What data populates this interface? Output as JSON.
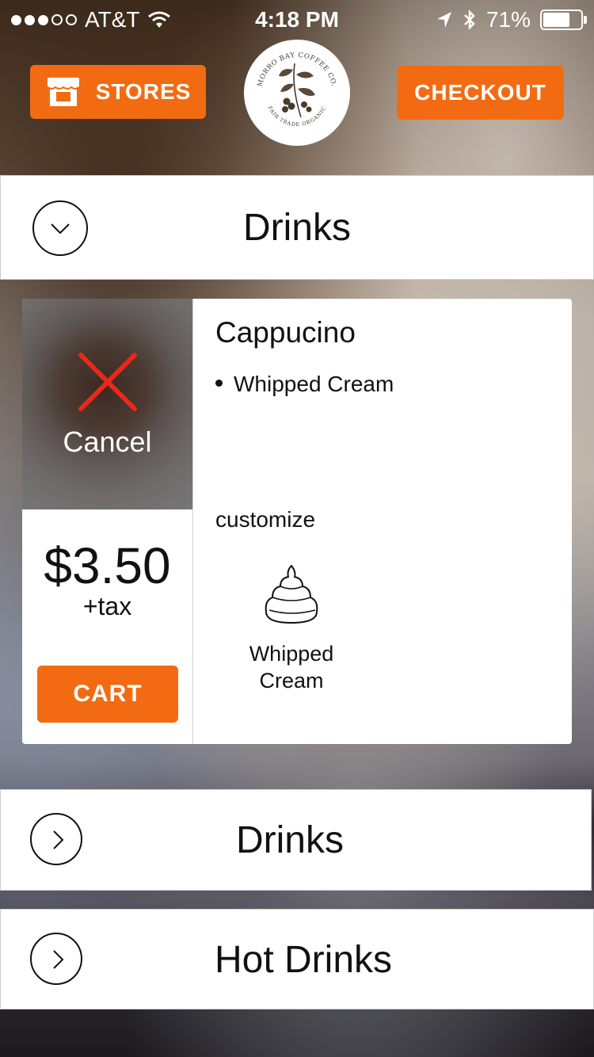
{
  "status_bar": {
    "carrier": "AT&T",
    "time": "4:18 PM",
    "battery": "71%",
    "battery_level": 0.71
  },
  "header": {
    "stores_label": "STORES",
    "checkout_label": "CHECKOUT",
    "logo_text_top": "MORRO BAY COFFEE CO.",
    "logo_text_bottom": "FAIR TRADE ORGANIC"
  },
  "categories": [
    {
      "label": "Drinks",
      "state": "expanded",
      "icon": "chevron-down-icon"
    },
    {
      "label": "Drinks",
      "state": "collapsed",
      "icon": "chevron-right-icon"
    },
    {
      "label": "Hot Drinks",
      "state": "collapsed",
      "icon": "chevron-right-icon"
    }
  ],
  "product": {
    "name": "Cappucino",
    "extras": [
      "Whipped Cream"
    ],
    "cancel_label": "Cancel",
    "price": "$3.50",
    "tax_label": "+tax",
    "cart_label": "CART",
    "customize_label": "customize",
    "options": [
      {
        "label": "Whipped\nCream",
        "icon": "whipped-cream-icon"
      }
    ]
  },
  "colors": {
    "accent": "#f26b12",
    "cancel_x": "#e8281c"
  }
}
